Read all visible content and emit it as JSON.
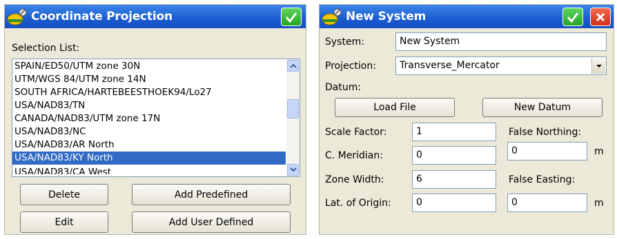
{
  "left_dialog": {
    "title": "Coordinate Projection",
    "selection_label": "Selection List:",
    "items": [
      "SPAIN/ED50/UTM zone 30N",
      "UTM/WGS 84/UTM zone 14N",
      "SOUTH AFRICA/HARTEBEESTHOEK94/Lo27",
      "USA/NAD83/TN",
      "CANADA/NAD83/UTM zone 17N",
      "USA/NAD83/NC",
      "USA/NAD83/AR North",
      "USA/NAD83/KY North",
      "USA/NAD83/CA West"
    ],
    "selected_item": "USA/NAD83/KY North",
    "buttons": {
      "delete": "Delete",
      "add_predefined": "Add Predefined",
      "edit": "Edit",
      "add_user_defined": "Add User Defined"
    }
  },
  "right_dialog": {
    "title": "New System",
    "system_label": "System:",
    "system_value": "New System",
    "projection_label": "Projection:",
    "projection_value": "Transverse_Mercator",
    "datum_label": "Datum:",
    "buttons": {
      "load_file": "Load File",
      "new_datum": "New Datum"
    },
    "scale_factor_label": "Scale Factor:",
    "scale_factor_value": "1",
    "c_meridian_label": "C. Meridian:",
    "c_meridian_value": "0",
    "zone_width_label": "Zone Width:",
    "zone_width_value": "6",
    "lat_origin_label": "Lat. of Origin:",
    "lat_origin_value": "0",
    "false_northing_label": "False Northing:",
    "false_northing_value": "0",
    "false_easting_label": "False Easting:",
    "false_easting_value": "0",
    "unit_m": "m"
  },
  "colors": {
    "title_bar": "#1a5bd0",
    "dialog_bg": "#ece9d8",
    "selection": "#316ac5",
    "ok_green": "#23a523",
    "close_red": "#d0301a"
  },
  "icons": {
    "title_icon": "helmet-satellite-icon",
    "ok": "checkmark-icon",
    "close": "close-x-icon",
    "scroll_up": "chevron-up-icon",
    "scroll_down": "chevron-down-icon",
    "dropdown": "chevron-down-icon"
  }
}
